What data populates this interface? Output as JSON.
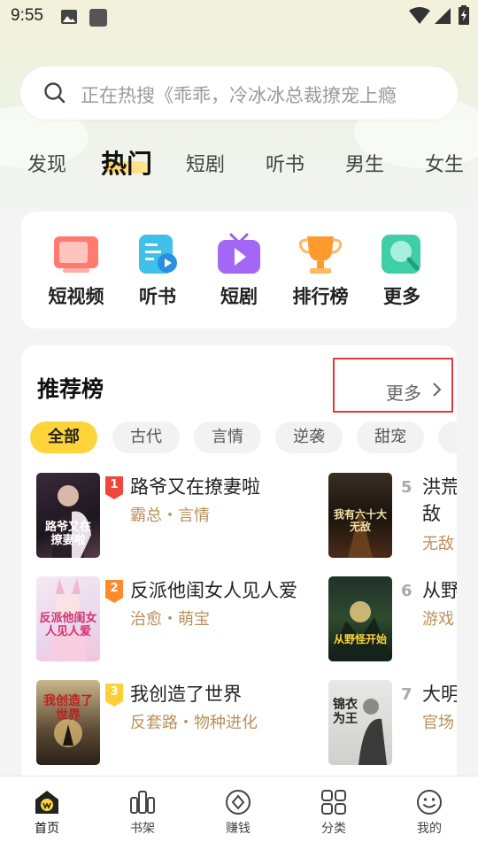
{
  "status_bar": {
    "time": "9:55"
  },
  "search": {
    "placeholder": "正在热搜《乖乖，冷冰冰总裁撩宠上瘾"
  },
  "tabs": [
    {
      "label": "发现"
    },
    {
      "label": "热门"
    },
    {
      "label": "短剧"
    },
    {
      "label": "听书"
    },
    {
      "label": "男生"
    },
    {
      "label": "女生"
    }
  ],
  "quick_entries": [
    {
      "label": "短视频",
      "icon": "short-video-icon"
    },
    {
      "label": "听书",
      "icon": "audiobook-icon"
    },
    {
      "label": "短剧",
      "icon": "short-drama-icon"
    },
    {
      "label": "排行榜",
      "icon": "trophy-icon"
    },
    {
      "label": "更多",
      "icon": "more-search-icon"
    }
  ],
  "recommend": {
    "title": "推荐榜",
    "more_label": "更多",
    "chips": [
      "全部",
      "古代",
      "言情",
      "逆袭",
      "甜宠"
    ],
    "books": [
      {
        "rank": "1",
        "name": "路爷又在撩妻啦",
        "tags": "霸总・言情",
        "cover_text": "路爷又在撩妻啦"
      },
      {
        "rank": "2",
        "name": "反派他闺女人见人爱",
        "tags": "治愈・萌宝",
        "cover_text": "反派他闺女人见人爱"
      },
      {
        "rank": "3",
        "name": "我创造了世界",
        "tags": "反套路・物种进化",
        "cover_text": "我创造了世界"
      },
      {
        "rank": "5",
        "name": "洪荒",
        "name2": "敌",
        "tags": "无敌",
        "cover_text": "我有六十大无敌"
      },
      {
        "rank": "6",
        "name": "从野",
        "tags": "游戏",
        "cover_text": "从野怪开始"
      },
      {
        "rank": "7",
        "name": "大明",
        "tags": "官场",
        "cover_text": "锦衣为王"
      }
    ]
  },
  "bottom_nav": [
    {
      "label": "首页",
      "icon": "home-icon"
    },
    {
      "label": "书架",
      "icon": "bookshelf-icon"
    },
    {
      "label": "赚钱",
      "icon": "earn-icon"
    },
    {
      "label": "分类",
      "icon": "category-icon"
    },
    {
      "label": "我的",
      "icon": "profile-icon"
    }
  ],
  "colors": {
    "accent": "#ffd43a",
    "tag": "#b9915a",
    "highlight_box": "#e03b3b"
  }
}
